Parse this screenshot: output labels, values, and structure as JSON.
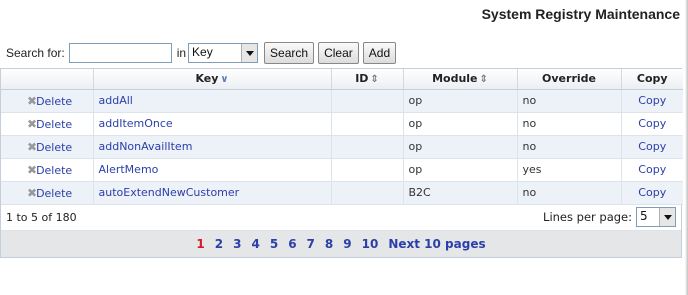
{
  "page": {
    "title": "System Registry Maintenance"
  },
  "search": {
    "label": "Search for:",
    "value": "",
    "placeholder": "",
    "in_label": "in",
    "field_selected": "Key",
    "search_button": "Search",
    "clear_button": "Clear",
    "add_button": "Add"
  },
  "table": {
    "columns": {
      "actions": "",
      "key": "Key",
      "id": "ID",
      "module": "Module",
      "override": "Override",
      "copy": "Copy"
    },
    "sort_icons": {
      "key": "sorted-descending-icon",
      "id": "sortable-icon",
      "module": "sortable-icon"
    },
    "rows": [
      {
        "delete": "Delete",
        "key": "addAll",
        "id": "",
        "module": "op",
        "override": "no",
        "copy": "Copy"
      },
      {
        "delete": "Delete",
        "key": "addItemOnce",
        "id": "",
        "module": "op",
        "override": "no",
        "copy": "Copy"
      },
      {
        "delete": "Delete",
        "key": "addNonAvailItem",
        "id": "",
        "module": "op",
        "override": "no",
        "copy": "Copy"
      },
      {
        "delete": "Delete",
        "key": "AlertMemo",
        "id": "",
        "module": "op",
        "override": "yes",
        "copy": "Copy"
      },
      {
        "delete": "Delete",
        "key": "autoExtendNewCustomer",
        "id": "",
        "module": "B2C",
        "override": "no",
        "copy": "Copy"
      }
    ]
  },
  "footer": {
    "range_text": "1 to 5 of 180",
    "lines_per_page_label": "Lines per page:",
    "lines_per_page_value": "5"
  },
  "pager": {
    "current": "1",
    "pages": [
      "2",
      "3",
      "4",
      "5",
      "6",
      "7",
      "8",
      "9",
      "10"
    ],
    "next_label": "Next 10 pages"
  },
  "colors": {
    "link": "#2a3fa8",
    "current_page": "#d31b2a",
    "row_alt": "#edf1f8",
    "pager_bg": "#e5e6e8"
  }
}
